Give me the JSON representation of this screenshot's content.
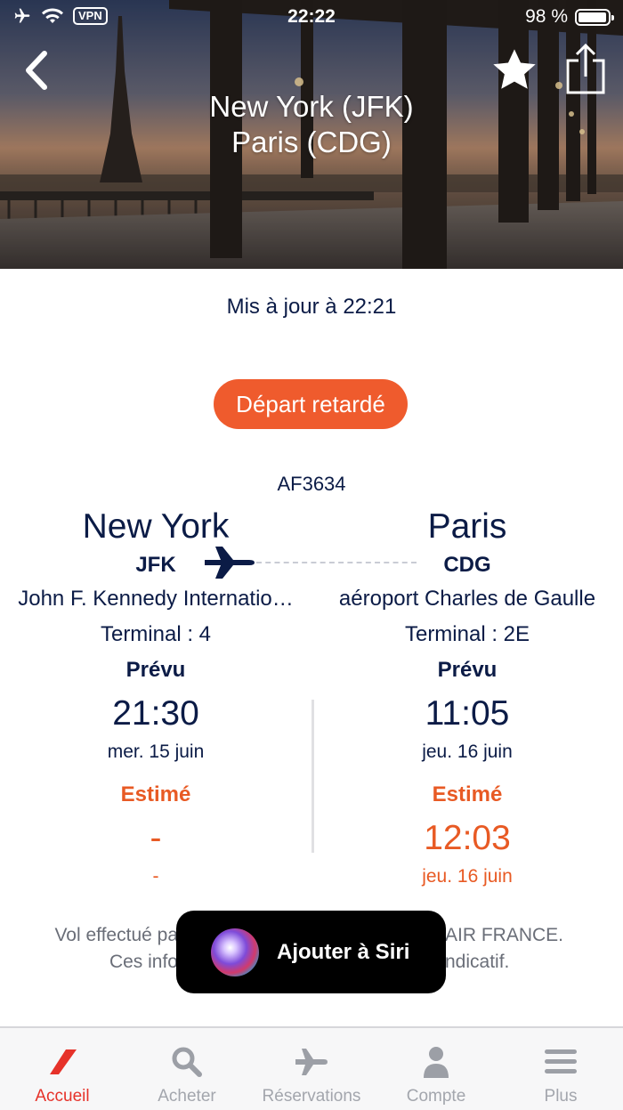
{
  "status_bar": {
    "time": "22:22",
    "vpn_label": "VPN",
    "battery_text": "98 %",
    "battery_level": 0.98
  },
  "header": {
    "route_line1": "New York (JFK)",
    "route_line2": "Paris (CDG)"
  },
  "updated_text": "Mis à jour à 22:21",
  "status_pill": {
    "label": "Départ retardé",
    "color": "#ef5b2d"
  },
  "flight_number": "AF3634",
  "departure": {
    "city": "New York",
    "code": "JFK",
    "airport": "John F. Kennedy Internatio…",
    "terminal": "Terminal : 4",
    "planned_label": "Prévu",
    "planned_time": "21:30",
    "planned_date": "mer. 15 juin",
    "estimated_label": "Estimé",
    "estimated_time": "-",
    "estimated_date": "-"
  },
  "arrival": {
    "city": "Paris",
    "code": "CDG",
    "airport": "aéroport Charles de Gaulle",
    "terminal": "Terminal : 2E",
    "planned_label": "Prévu",
    "planned_time": "11:05",
    "planned_date": "jeu. 16 juin",
    "estimated_label": "Estimé",
    "estimated_time": "12:03",
    "estimated_date": "jeu. 16 juin"
  },
  "operator_note": {
    "line1_left": "Vol effectué pa",
    "line1_right": "AIR FRANCE.",
    "line2_left": "Ces info",
    "line2_right": "ndicatif."
  },
  "siri_toast": {
    "label": "Ajouter à Siri"
  },
  "tabbar": {
    "items": [
      {
        "label": "Accueil",
        "icon": "air-france-logo-icon"
      },
      {
        "label": "Acheter",
        "icon": "search-icon"
      },
      {
        "label": "Réservations",
        "icon": "plane-icon"
      },
      {
        "label": "Compte",
        "icon": "person-icon"
      },
      {
        "label": "Plus",
        "icon": "menu-icon"
      }
    ]
  },
  "colors": {
    "accent_orange": "#e85a24",
    "navy": "#0b1b46",
    "active_tab": "#e6322a"
  }
}
